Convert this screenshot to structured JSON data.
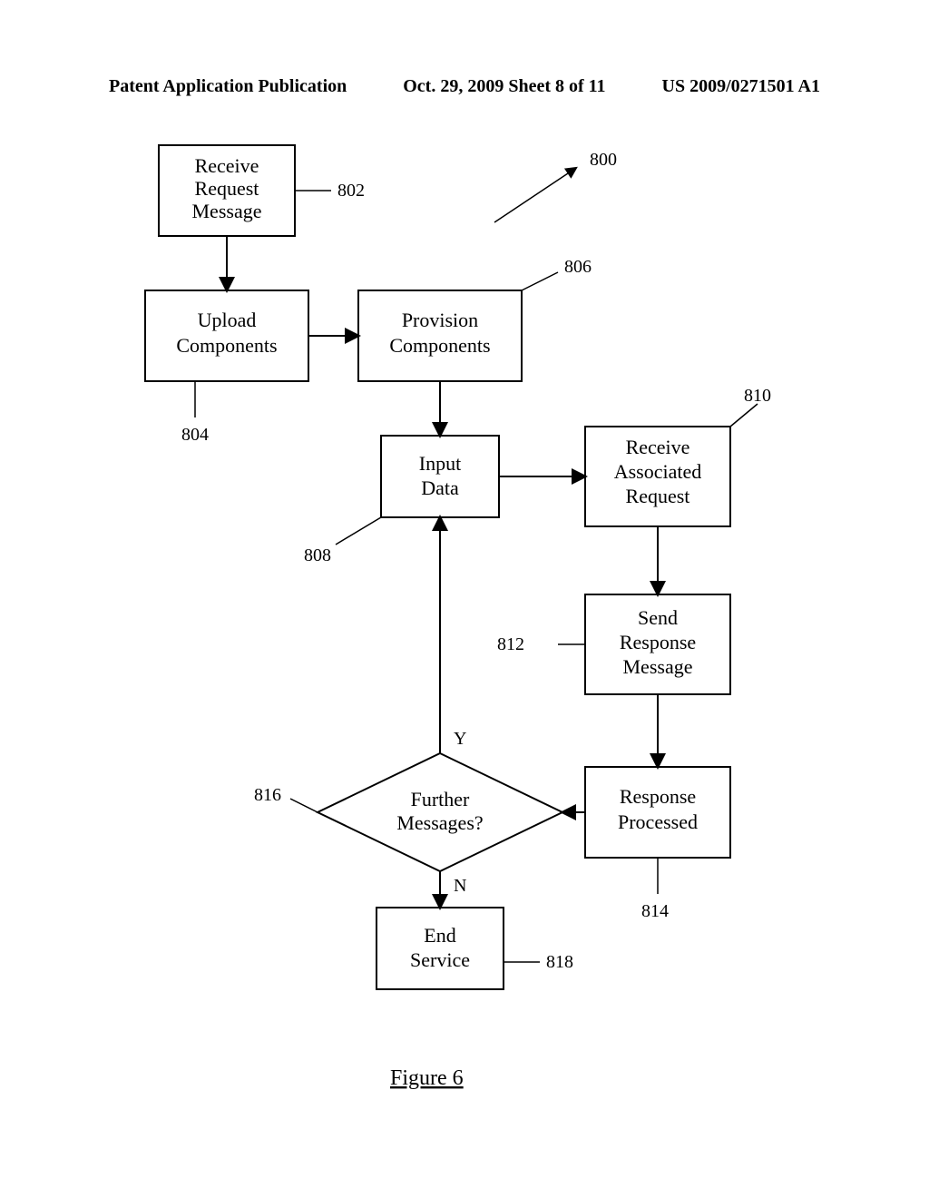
{
  "header": {
    "left": "Patent Application Publication",
    "center": "Oct. 29, 2009  Sheet 8 of 11",
    "right": "US 2009/0271501 A1"
  },
  "figcap": "Figure 6",
  "boxes": {
    "b802": {
      "l1": "Receive",
      "l2": "Request",
      "l3": "Message"
    },
    "b804": {
      "l1": "Upload",
      "l2": "Components"
    },
    "b806": {
      "l1": "Provision",
      "l2": "Components"
    },
    "b808": {
      "l1": "Input",
      "l2": "Data"
    },
    "b810": {
      "l1": "Receive",
      "l2": "Associated",
      "l3": "Request"
    },
    "b812": {
      "l1": "Send",
      "l2": "Response",
      "l3": "Message"
    },
    "b814": {
      "l1": "Response",
      "l2": "Processed"
    },
    "b816": {
      "l1": "Further",
      "l2": "Messages?"
    },
    "b818": {
      "l1": "End",
      "l2": "Service"
    }
  },
  "refs": {
    "r800": "800",
    "r802": "802",
    "r804": "804",
    "r806": "806",
    "r808": "808",
    "r810": "810",
    "r812": "812",
    "r814": "814",
    "r816": "816",
    "r818": "818"
  },
  "yn": {
    "y": "Y",
    "n": "N"
  }
}
